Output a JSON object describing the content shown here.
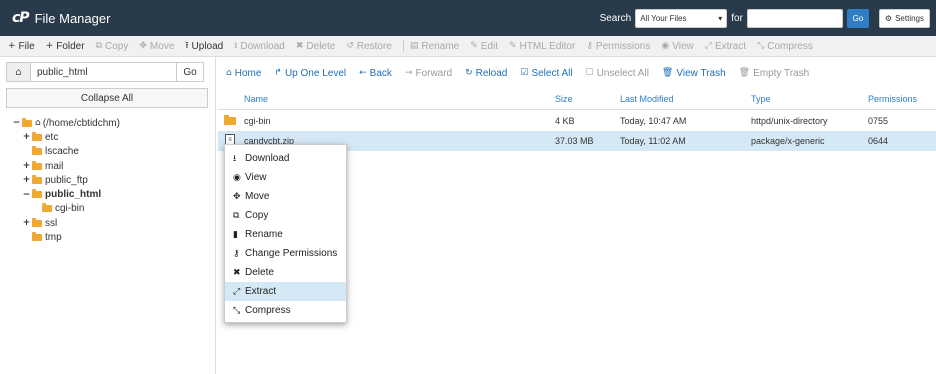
{
  "header": {
    "logo": "cP",
    "title": "File Manager",
    "search_label": "Search",
    "search_scope": "All Your Files",
    "for_label": "for",
    "search_value": "",
    "go_label": "Go",
    "settings_label": "Settings"
  },
  "toolbar": {
    "items": [
      {
        "label": "File",
        "icon": "+",
        "enabled": true
      },
      {
        "label": "Folder",
        "icon": "+",
        "enabled": true
      },
      {
        "label": "Copy",
        "icon": "⧉",
        "enabled": false
      },
      {
        "label": "Move",
        "icon": "✥",
        "enabled": false
      },
      {
        "label": "Upload",
        "icon": "⭱",
        "enabled": true
      },
      {
        "label": "Download",
        "icon": "⭳",
        "enabled": false
      },
      {
        "label": "Delete",
        "icon": "✖",
        "enabled": false
      },
      {
        "label": "Restore",
        "icon": "↺",
        "enabled": false
      },
      {
        "label": "Rename",
        "icon": "▤",
        "enabled": false
      },
      {
        "label": "Edit",
        "icon": "✎",
        "enabled": false
      },
      {
        "label": "HTML Editor",
        "icon": "✎",
        "enabled": false
      },
      {
        "label": "Permissions",
        "icon": "⚷",
        "enabled": false
      },
      {
        "label": "View",
        "icon": "◉",
        "enabled": false
      },
      {
        "label": "Extract",
        "icon": "⤢",
        "enabled": false
      },
      {
        "label": "Compress",
        "icon": "⤡",
        "enabled": false
      }
    ]
  },
  "left": {
    "path_value": "public_html",
    "go_label": "Go",
    "collapse_label": "Collapse All",
    "tree": [
      {
        "label": "(/home/cbtidchm)",
        "toggle": "−",
        "level": 0,
        "home": true,
        "bold": false
      },
      {
        "label": "etc",
        "toggle": "+",
        "level": 1,
        "bold": false
      },
      {
        "label": "lscache",
        "toggle": "",
        "level": 1,
        "bold": false
      },
      {
        "label": "mail",
        "toggle": "+",
        "level": 1,
        "bold": false
      },
      {
        "label": "public_ftp",
        "toggle": "+",
        "level": 1,
        "bold": false
      },
      {
        "label": "public_html",
        "toggle": "−",
        "level": 1,
        "bold": true
      },
      {
        "label": "cgi-bin",
        "toggle": "",
        "level": 2,
        "bold": false
      },
      {
        "label": "ssl",
        "toggle": "+",
        "level": 1,
        "bold": false
      },
      {
        "label": "tmp",
        "toggle": "",
        "level": 1,
        "bold": false
      }
    ]
  },
  "nav": {
    "items": [
      {
        "label": "Home",
        "icon": "⌂",
        "enabled": true
      },
      {
        "label": "Up One Level",
        "icon": "↱",
        "enabled": true
      },
      {
        "label": "Back",
        "icon": "←",
        "enabled": true
      },
      {
        "label": "Forward",
        "icon": "→",
        "enabled": false
      },
      {
        "label": "Reload",
        "icon": "↻",
        "enabled": true
      },
      {
        "label": "Select All",
        "icon": "☑",
        "enabled": true
      },
      {
        "label": "Unselect All",
        "icon": "☐",
        "enabled": false
      },
      {
        "label": "View Trash",
        "icon": "🗑",
        "enabled": true
      },
      {
        "label": "Empty Trash",
        "icon": "🗑",
        "enabled": false
      }
    ]
  },
  "table": {
    "headers": {
      "name": "Name",
      "size": "Size",
      "modified": "Last Modified",
      "type": "Type",
      "perms": "Permissions"
    },
    "rows": [
      {
        "name": "cgi-bin",
        "size": "4 KB",
        "modified": "Today, 10:47 AM",
        "type": "httpd/unix-directory",
        "perms": "0755",
        "kind": "folder"
      },
      {
        "name": "candycbt.zip",
        "size": "37.03 MB",
        "modified": "Today, 11:02 AM",
        "type": "package/x-generic",
        "perms": "0644",
        "kind": "file"
      }
    ]
  },
  "context_menu": {
    "items": [
      {
        "label": "Download",
        "icon": "⭳"
      },
      {
        "label": "View",
        "icon": "◉"
      },
      {
        "label": "Move",
        "icon": "✥"
      },
      {
        "label": "Copy",
        "icon": "⧉"
      },
      {
        "label": "Rename",
        "icon": "▮"
      },
      {
        "label": "Change Permissions",
        "icon": "⚷"
      },
      {
        "label": "Delete",
        "icon": "✖"
      },
      {
        "label": "Extract",
        "icon": "⤢"
      },
      {
        "label": "Compress",
        "icon": "⤡"
      }
    ],
    "highlighted": "Extract"
  },
  "colors": {
    "header_bg": "#293a4a",
    "accent": "#2f7dc4",
    "folder": "#f0a830",
    "selection": "#d5e8f5"
  }
}
